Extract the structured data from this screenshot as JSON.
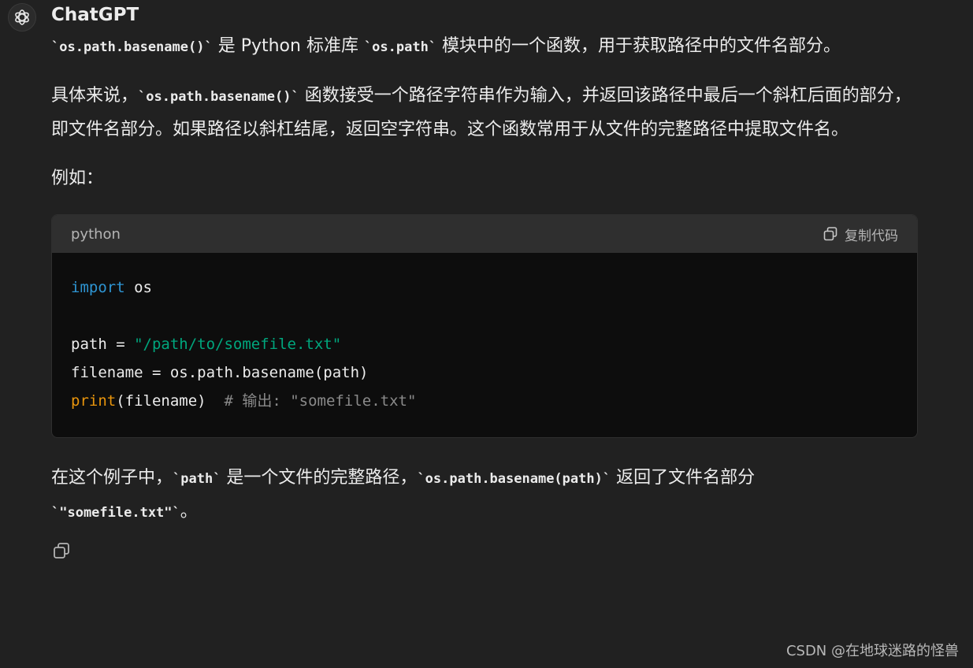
{
  "message": {
    "author": "ChatGPT",
    "intro": {
      "code1": "`os.path.basename()`",
      "text1": " 是 Python 标准库 ",
      "code2": "`os.path`",
      "text2": " 模块中的一个函数，用于获取路径中的文件名部分。"
    },
    "detail": {
      "text1": "具体来说，",
      "code1": "`os.path.basename()`",
      "text2": " 函数接受一个路径字符串作为输入，并返回该路径中最后一个斜杠后面的部分，即文件名部分。如果路径以斜杠结尾，返回空字符串。这个函数常用于从文件的完整路径中提取文件名。"
    },
    "example_label": "例如：",
    "code_block": {
      "language": "python",
      "copy_label": "复制代码",
      "lines": {
        "l1_kw": "import",
        "l1_rest": " os",
        "l3_pre": "path = ",
        "l3_str": "\"/path/to/somefile.txt\"",
        "l4": "filename = os.path.basename(path)",
        "l5_fn": "print",
        "l5_rest": "(filename)  ",
        "l5_comment": "# 输出: \"somefile.txt\""
      }
    },
    "conclusion": {
      "text1": "在这个例子中，",
      "code1": "`path`",
      "text2": " 是一个文件的完整路径，",
      "code2": "`os.path.basename(path)`",
      "text3": " 返回了文件名部分",
      "code3": "`\"somefile.txt\"`",
      "text4": "。"
    }
  },
  "watermark": "CSDN @在地球迷路的怪兽",
  "colors": {
    "background": "#212121",
    "code_background": "#0d0d0d",
    "code_header": "#2f2f2f",
    "keyword": "#2e95d3",
    "string": "#00a67d",
    "builtin": "#e9950c",
    "comment": "#8a8a8a"
  },
  "icons": {
    "avatar": "openai-logo-icon",
    "copy": "copy-icon"
  }
}
